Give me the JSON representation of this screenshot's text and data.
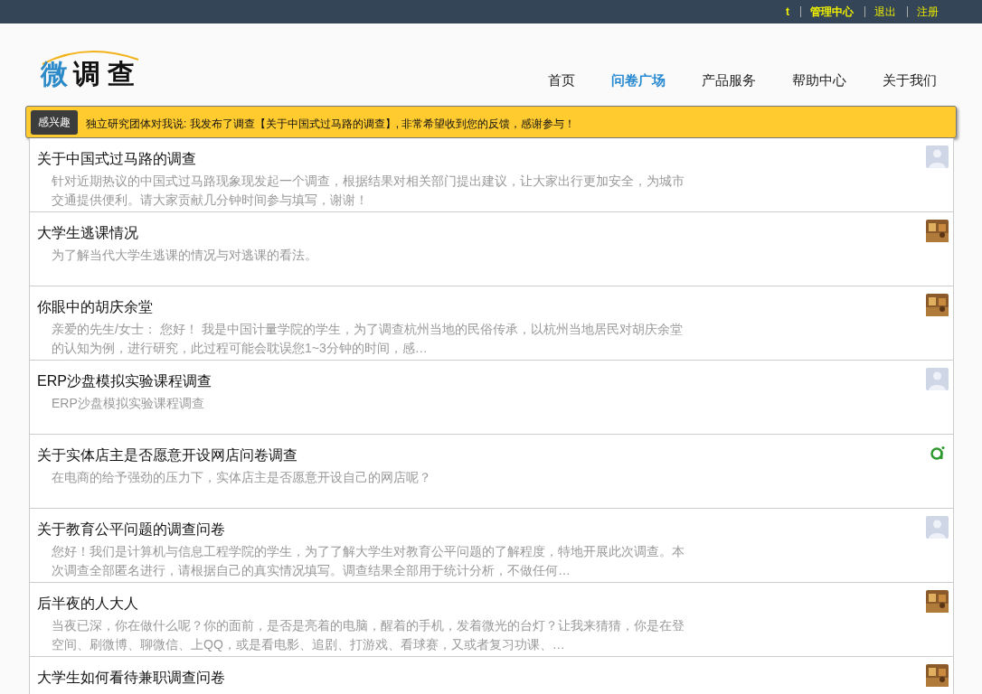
{
  "top_links": [
    {
      "label": "t",
      "bold": true
    },
    {
      "label": "管理中心",
      "bold": true
    },
    {
      "label": "退出",
      "bold": false
    },
    {
      "label": "注册",
      "bold": false
    }
  ],
  "logo": {
    "accent": "微",
    "rest": "调 查"
  },
  "nav": [
    {
      "label": "首页",
      "selected": false
    },
    {
      "label": "问卷广场",
      "selected": true
    },
    {
      "label": "产品服务",
      "selected": false
    },
    {
      "label": "帮助中心",
      "selected": false
    },
    {
      "label": "关于我们",
      "selected": false
    }
  ],
  "notice": {
    "button": "感兴趣",
    "message": "独立研究团体对我说: 我发布了调查【关于中国式过马路的调查】, 非常希望收到您的反馈，感谢参与！"
  },
  "surveys": [
    {
      "title": "关于中国式过马路的调查",
      "description": "针对近期热议的中国式过马路现象现发起一个调查，根据结果对相关部门提出建议，让大家出行更加安全，为城市交通提供便利。请大家贡献几分钟时间参与填写，谢谢！",
      "kind": "default"
    },
    {
      "title": "大学生逃课情况",
      "description": "为了解当代大学生逃课的情况与对逃课的看法。",
      "kind": "picture"
    },
    {
      "title": "你眼中的胡庆余堂",
      "description": "亲爱的先生/女士： 您好！ 我是中国计量学院的学生，为了调查杭州当地的民俗传承，以杭州当地居民对胡庆余堂的认知为例，进行研究，此过程可能会耽误您1~3分钟的时间，感…",
      "kind": "picture"
    },
    {
      "title": "ERP沙盘模拟实验课程调查",
      "description": "ERP沙盘模拟实验课程调查",
      "kind": "default"
    },
    {
      "title": "关于实体店主是否愿意开设网店问卷调查",
      "description": "在电商的给予强劲的压力下，实体店主是否愿意开设自己的网店呢？",
      "kind": "logo"
    },
    {
      "title": "关于教育公平问题的调查问卷",
      "description": "您好！我们是计算机与信息工程学院的学生，为了了解大学生对教育公平问题的了解程度，特地开展此次调查。本次调查全部匿名进行，请根据自己的真实情况填写。调查结果全部用于统计分析，不做任何…",
      "kind": "default"
    },
    {
      "title": "后半夜的人大人",
      "description": "当夜已深，你在做什么呢？你的面前，是否是亮着的电脑，醒着的手机，发着微光的台灯？让我来猜猜，你是在登空间、刷微博、聊微信、上QQ，或是看电影、追剧、打游戏、看球赛，又或者复习功课、…",
      "kind": "picture"
    },
    {
      "title": "大学生如何看待兼职调查问卷",
      "kind": "picture"
    }
  ]
}
